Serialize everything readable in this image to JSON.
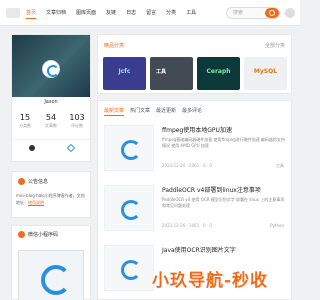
{
  "header": {
    "nav": [
      "首页",
      "文章归档",
      "图库页面",
      "友链",
      "日志",
      "留言",
      "分类",
      "工具"
    ],
    "search_placeholder": "搜索"
  },
  "profile": {
    "name": "Jason",
    "stats": [
      {
        "value": "15",
        "label": "分类数"
      },
      {
        "value": "54",
        "label": "文章数"
      },
      {
        "value": "103",
        "label": "评论数"
      }
    ]
  },
  "notice": {
    "title": "公告信息",
    "text": "mini-blog-halo小程序博客作者，文档地址：",
    "link": "使用说明"
  },
  "mini_program": {
    "title": "微信小程序码"
  },
  "featured": {
    "title": "精品分类",
    "more": "全部分类",
    "items": [
      "Jcfc",
      "工具",
      "Ceraph",
      "MySQL"
    ]
  },
  "articles": {
    "tabs": [
      "最新文章",
      "热门文章",
      "最近更新",
      "最多评论"
    ],
    "list": [
      {
        "title": "ffmpeg使用本地GPU加速",
        "excerpt": "ffmpeg基础编码器硬件加速 使用ffmpeg进行硬件加速 编码器的支持情况 使用 AMD GPU 加速",
        "meta": "2023-12-20 · 2061 · 0 · 0",
        "tag": "工具"
      },
      {
        "title": "PaddleOCR v4部署到linux注意事项",
        "excerpt": "PaddleOCR v4 使用 OCR 模型识别文字 部署在 linux 上的注意事项和常见问题处理",
        "meta": "2023-12-26 · 2061 · 0 · 0",
        "tag": "Python"
      },
      {
        "title": "Java使用OCR识别图片文字",
        "excerpt": "",
        "meta": "",
        "tag": ""
      }
    ]
  },
  "watermark": "小玖导航-秒收"
}
